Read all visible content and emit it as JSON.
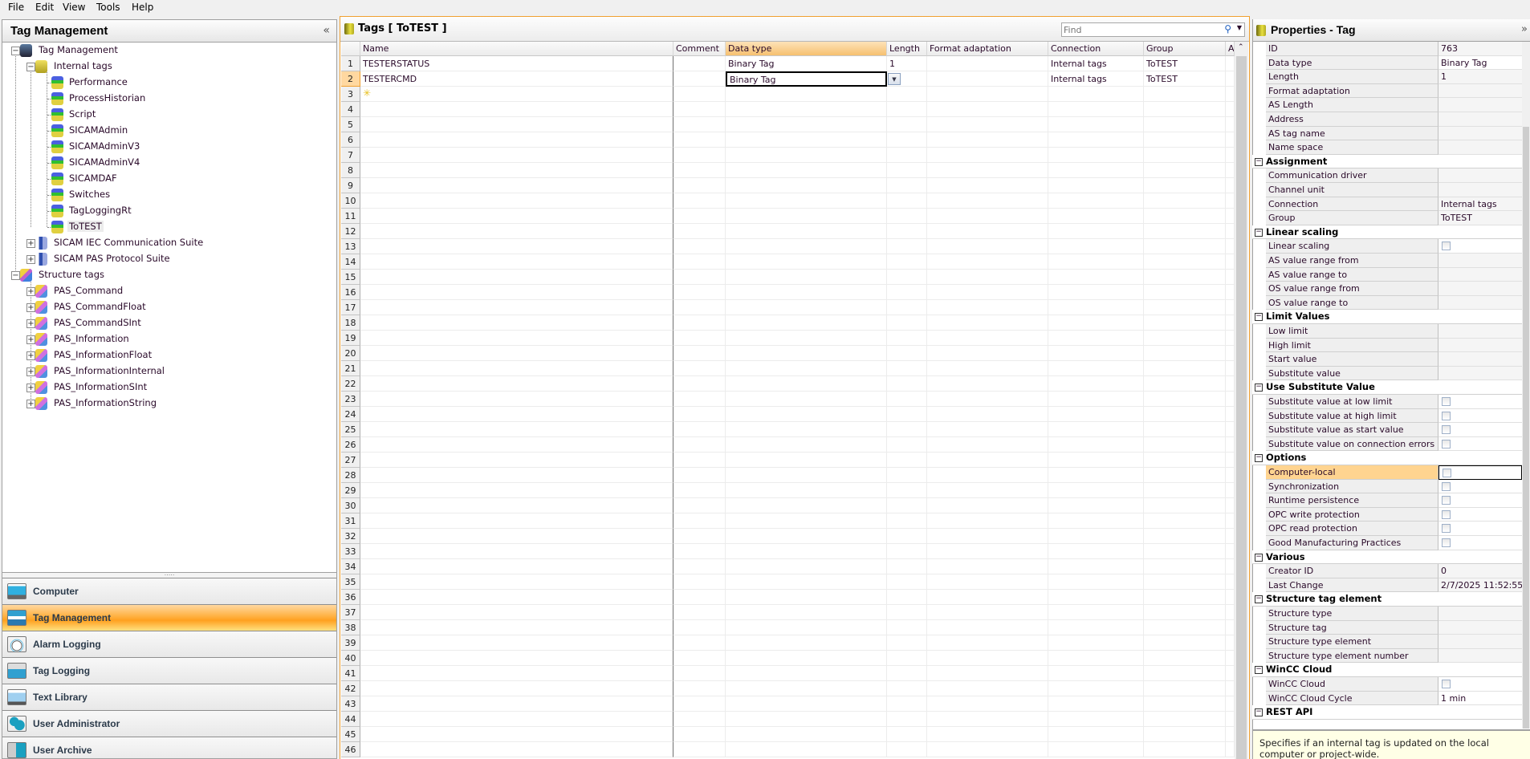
{
  "menu": [
    "File",
    "Edit",
    "View",
    "Tools",
    "Help"
  ],
  "left": {
    "title": "Tag Management",
    "collapse": "«",
    "splitter": ".....",
    "tree": [
      {
        "label": "Tag Management",
        "level": 0,
        "icon": "tag-management",
        "exp": "−"
      },
      {
        "label": "Internal tags",
        "level": 1,
        "icon": "internal-tags",
        "exp": "−"
      },
      {
        "label": "Performance",
        "level": 2,
        "icon": "group"
      },
      {
        "label": "ProcessHistorian",
        "level": 2,
        "icon": "group"
      },
      {
        "label": "Script",
        "level": 2,
        "icon": "group"
      },
      {
        "label": "SICAMAdmin",
        "level": 2,
        "icon": "group"
      },
      {
        "label": "SICAMAdminV3",
        "level": 2,
        "icon": "group"
      },
      {
        "label": "SICAMAdminV4",
        "level": 2,
        "icon": "group"
      },
      {
        "label": "SICAMDAF",
        "level": 2,
        "icon": "group"
      },
      {
        "label": "Switches",
        "level": 2,
        "icon": "group"
      },
      {
        "label": "TagLoggingRt",
        "level": 2,
        "icon": "group"
      },
      {
        "label": "ToTEST",
        "level": 2,
        "icon": "group",
        "selected": true
      },
      {
        "label": "SICAM IEC Communication Suite",
        "level": 1,
        "icon": "driver",
        "exp": "+"
      },
      {
        "label": "SICAM PAS Protocol Suite",
        "level": 1,
        "icon": "driver",
        "exp": "+"
      },
      {
        "label": "Structure tags",
        "level": 0,
        "icon": "structure",
        "exp": "−"
      },
      {
        "label": "PAS_Command",
        "level": 1,
        "icon": "structure-type",
        "exp": "+"
      },
      {
        "label": "PAS_CommandFloat",
        "level": 1,
        "icon": "structure-type",
        "exp": "+"
      },
      {
        "label": "PAS_CommandSInt",
        "level": 1,
        "icon": "structure-type",
        "exp": "+"
      },
      {
        "label": "PAS_Information",
        "level": 1,
        "icon": "structure-type",
        "exp": "+"
      },
      {
        "label": "PAS_InformationFloat",
        "level": 1,
        "icon": "structure-type",
        "exp": "+"
      },
      {
        "label": "PAS_InformationInternal",
        "level": 1,
        "icon": "structure-type",
        "exp": "+"
      },
      {
        "label": "PAS_InformationSInt",
        "level": 1,
        "icon": "structure-type",
        "exp": "+"
      },
      {
        "label": "PAS_InformationString",
        "level": 1,
        "icon": "structure-type",
        "exp": "+"
      }
    ],
    "nav": [
      {
        "label": "Computer",
        "icon": "computer"
      },
      {
        "label": "Tag Management",
        "icon": "tag-management",
        "active": true
      },
      {
        "label": "Alarm Logging",
        "icon": "bell"
      },
      {
        "label": "Tag Logging",
        "icon": "database"
      },
      {
        "label": "Text Library",
        "icon": "text-library"
      },
      {
        "label": "User Administrator",
        "icon": "users"
      },
      {
        "label": "User Archive",
        "icon": "user-archive"
      }
    ]
  },
  "center": {
    "title": "Tags [ ToTEST ]",
    "find_placeholder": "Find",
    "columns": [
      "Name",
      "Comment",
      "Data type",
      "Length",
      "Format adaptation",
      "Connection",
      "Group",
      "A"
    ],
    "row_count": 46,
    "rows": [
      {
        "name": "TESTERSTATUS",
        "comment": "",
        "data_type": "Binary Tag",
        "length": "1",
        "format": "",
        "connection": "Internal tags",
        "group": "ToTEST"
      },
      {
        "name": "TESTERCMD",
        "comment": "",
        "data_type": "Binary Tag",
        "length": "",
        "format": "",
        "connection": "Internal tags",
        "group": "ToTEST"
      }
    ],
    "selected_row": 2
  },
  "props": {
    "title": "Properties - Tag",
    "expand": "»",
    "sections": [
      {
        "header": null,
        "rows": [
          {
            "label": "ID",
            "value": "763"
          },
          {
            "label": "Data type",
            "value": "Binary Tag",
            "edit": true
          },
          {
            "label": "Length",
            "value": "1"
          },
          {
            "label": "Format adaptation",
            "value": ""
          },
          {
            "label": "AS Length",
            "value": ""
          },
          {
            "label": "Address",
            "value": ""
          },
          {
            "label": "AS tag name",
            "value": ""
          },
          {
            "label": "Name space",
            "value": ""
          }
        ]
      },
      {
        "header": "Assignment",
        "rows": [
          {
            "label": "Communication driver",
            "value": ""
          },
          {
            "label": "Channel unit",
            "value": ""
          },
          {
            "label": "Connection",
            "value": "Internal tags"
          },
          {
            "label": "Group",
            "value": "ToTEST"
          }
        ]
      },
      {
        "header": "Linear scaling",
        "rows": [
          {
            "label": "Linear scaling",
            "checkbox": false
          },
          {
            "label": "AS value range from",
            "value": ""
          },
          {
            "label": "AS value range to",
            "value": ""
          },
          {
            "label": "OS value range from",
            "value": ""
          },
          {
            "label": "OS value range to",
            "value": ""
          }
        ]
      },
      {
        "header": "Limit Values",
        "rows": [
          {
            "label": "Low limit",
            "value": ""
          },
          {
            "label": "High limit",
            "value": ""
          },
          {
            "label": "Start value",
            "value": ""
          },
          {
            "label": "Substitute value",
            "value": ""
          }
        ]
      },
      {
        "header": "Use Substitute Value",
        "rows": [
          {
            "label": "Substitute value at low limit",
            "checkbox": false
          },
          {
            "label": "Substitute value at high limit",
            "checkbox": false
          },
          {
            "label": "Substitute value as start value",
            "checkbox": false
          },
          {
            "label": "Substitute value on connection errors",
            "checkbox": false
          }
        ]
      },
      {
        "header": "Options",
        "rows": [
          {
            "label": "Computer-local",
            "checkbox": false,
            "selected": true,
            "edit": true
          },
          {
            "label": "Synchronization",
            "checkbox": false,
            "edit": true
          },
          {
            "label": "Runtime persistence",
            "checkbox": false,
            "edit": true
          },
          {
            "label": "OPC write protection",
            "checkbox": false,
            "edit": true
          },
          {
            "label": "OPC read protection",
            "checkbox": false,
            "edit": true
          },
          {
            "label": "Good Manufacturing Practices",
            "checkbox": false,
            "edit": true
          }
        ]
      },
      {
        "header": "Various",
        "rows": [
          {
            "label": "Creator ID",
            "value": "0"
          },
          {
            "label": "Last Change",
            "value": "2/7/2025 11:52:55"
          }
        ]
      },
      {
        "header": "Structure tag element",
        "rows": [
          {
            "label": "Structure type",
            "value": ""
          },
          {
            "label": "Structure tag",
            "value": ""
          },
          {
            "label": "Structure type element",
            "value": ""
          },
          {
            "label": "Structure type element number",
            "value": ""
          }
        ]
      },
      {
        "header": "WinCC Cloud",
        "rows": [
          {
            "label": "WinCC Cloud",
            "checkbox": false,
            "edit": true
          },
          {
            "label": "WinCC Cloud Cycle",
            "value": "1 min",
            "edit": true
          }
        ]
      },
      {
        "header": "REST API",
        "rows": []
      }
    ],
    "description": "Specifies if an internal tag is updated on the local computer or project-wide."
  },
  "colors": {
    "accent": "#f7a030",
    "selected": "#ffd490",
    "panel_border": "#a0a0a0"
  }
}
